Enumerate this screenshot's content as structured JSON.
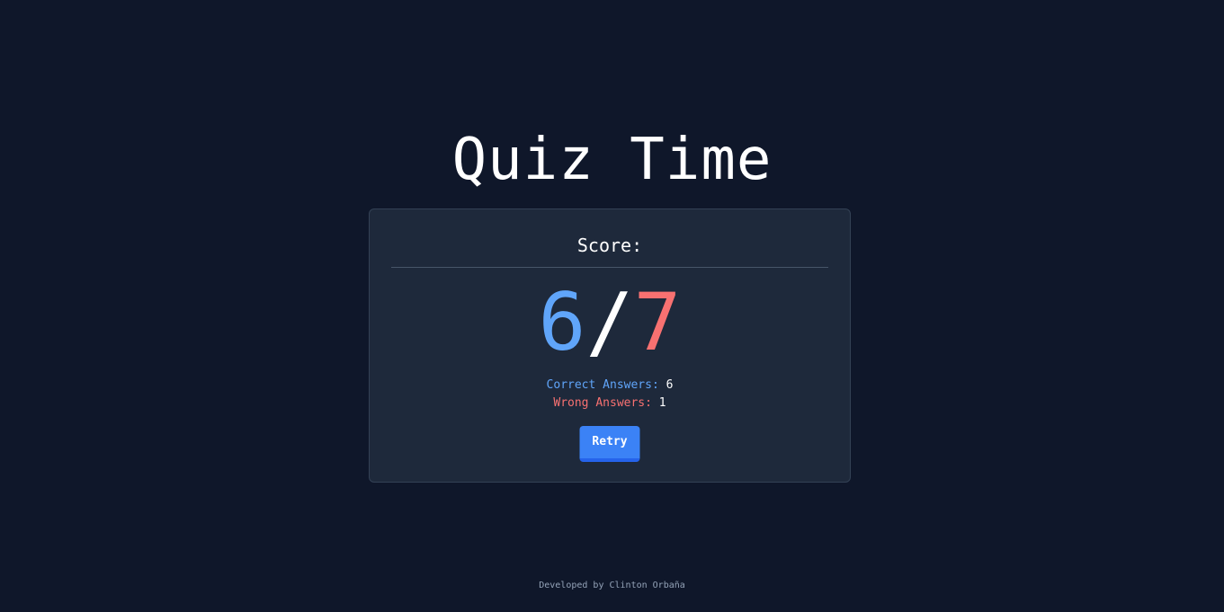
{
  "app": {
    "title": "Quiz Time"
  },
  "score_card": {
    "label": "Score:",
    "correct": "6",
    "separator": "/",
    "total": "7",
    "correct_label": "Correct Answers:",
    "correct_value": "6",
    "wrong_label": "Wrong Answers:",
    "wrong_value": "1",
    "retry_label": "Retry"
  },
  "footer": {
    "text": "Developed by Clinton Orbaña"
  },
  "colors": {
    "background": "#0f172a",
    "card": "#1e293b",
    "correct": "#60a5fa",
    "wrong": "#f87171",
    "button": "#3b82f6"
  }
}
